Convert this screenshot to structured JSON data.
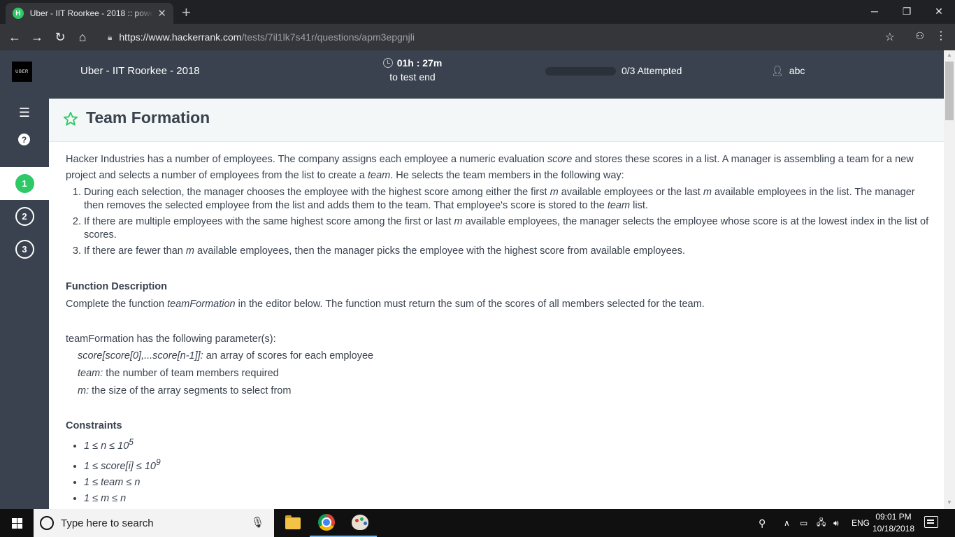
{
  "browser": {
    "tab_title": "Uber - IIT Roorkee - 2018 :: powe",
    "tab_favicon": "H",
    "url_host": "https://www.hackerrank.com",
    "url_path": "/tests/7il1lk7s41r/questions/apm3epgnjli"
  },
  "header": {
    "logo_text": "UBER",
    "test_name": "Uber - IIT Roorkee - 2018",
    "timer_value": "01h : 27m",
    "timer_label": "to test end",
    "progress_fraction": 0,
    "attempted": "0/3 Attempted",
    "username": "abc"
  },
  "sidebar": {
    "help": "?",
    "questions": [
      "1",
      "2",
      "3"
    ],
    "active_index": 0
  },
  "question": {
    "title": "Team Formation",
    "intro_1": "Hacker Industries has a number of employees. The company assigns each employee a numeric evaluation ",
    "intro_score": "score",
    "intro_2": " and stores these scores in a list. A manager is assembling a team for a new project and selects a number of employees from the list to create a ",
    "intro_team": "team",
    "intro_3": ". He selects the team members in the following way:",
    "rule1_a": "During each selection, the manager chooses the employee with the highest score among either the first ",
    "rule1_m1": "m",
    "rule1_b": " available employees or the last ",
    "rule1_m2": "m",
    "rule1_c": " available employees in the list. The manager then removes the selected employee from the list and adds them to the team. That employee's score is stored to the ",
    "rule1_team": "team",
    "rule1_d": " list.",
    "rule2_a": "If there are multiple employees with the same highest score among the first or last ",
    "rule2_m": "m",
    "rule2_b": " available employees, the manager selects the employee whose score is at the lowest index in the list of scores.",
    "rule3_a": "If there are fewer than ",
    "rule3_m": "m",
    "rule3_b": " available employees, then the manager picks the employee with the highest score from available employees.",
    "func_heading": "Function Description",
    "func_a": "Complete the function ",
    "func_name": "teamFormation",
    "func_b": " in the editor below. The function must return the sum of the scores of all members selected for the team.",
    "params_intro": "teamFormation has the following parameter(s):",
    "param1_name": "score[score[0],...score[n-1]]:",
    "param1_desc": "  an array of scores for each employee",
    "param2_name": "team:",
    "param2_desc": "  the number of team members required",
    "param3_name": "m:",
    "param3_desc": "  the size of the array segments to select from",
    "constraints_heading": "Constraints",
    "c1": "1 ≤ n ≤ 10",
    "c1_sup": "5",
    "c2": "1 ≤ score[i] ≤ 10",
    "c2_sup": "9",
    "c3": "1 ≤ team ≤ n",
    "c4": "1 ≤ m ≤ n"
  },
  "taskbar": {
    "search_placeholder": "Type here to search",
    "lang": "ENG",
    "time": "09:01 PM",
    "date": "10/18/2018"
  }
}
